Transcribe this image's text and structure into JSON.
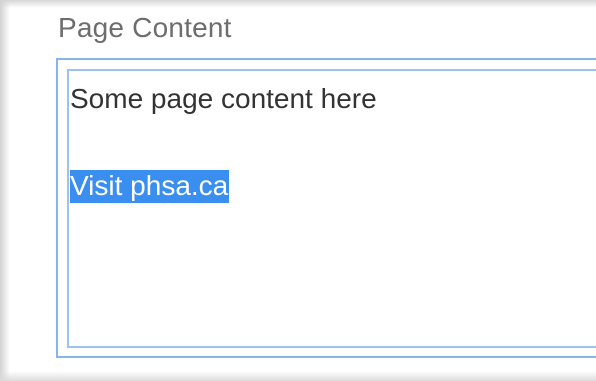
{
  "field": {
    "label": "Page Content"
  },
  "editor": {
    "lines": [
      "Some page content here",
      "Visit phsa.ca"
    ],
    "selected_text": "Visit phsa.ca"
  },
  "colors": {
    "label_text": "#6d6d6d",
    "body_text": "#333333",
    "focus_border": "#86b6e8",
    "selection_bg": "#3a8ef0",
    "selection_text": "#ffffff"
  }
}
